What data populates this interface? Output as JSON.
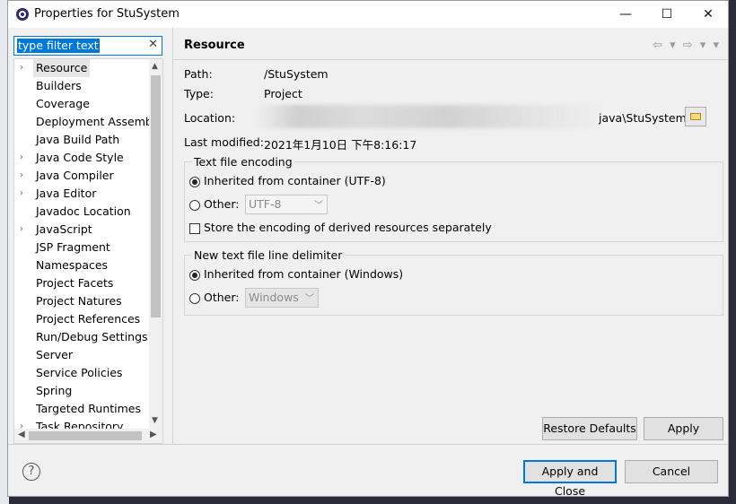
{
  "window": {
    "title": "Properties for StuSystem",
    "minimize": "—",
    "maximize": "☐",
    "close": "✕"
  },
  "filter": {
    "value": "type filter text",
    "clear": "✕"
  },
  "tree": {
    "items": [
      {
        "label": "Resource",
        "arrow": "›",
        "selected": true
      },
      {
        "label": "Builders",
        "arrow": ""
      },
      {
        "label": "Coverage",
        "arrow": ""
      },
      {
        "label": "Deployment Assembly",
        "arrow": ""
      },
      {
        "label": "Java Build Path",
        "arrow": ""
      },
      {
        "label": "Java Code Style",
        "arrow": "›"
      },
      {
        "label": "Java Compiler",
        "arrow": "›"
      },
      {
        "label": "Java Editor",
        "arrow": "›"
      },
      {
        "label": "Javadoc Location",
        "arrow": ""
      },
      {
        "label": "JavaScript",
        "arrow": "›"
      },
      {
        "label": "JSP Fragment",
        "arrow": ""
      },
      {
        "label": "Namespaces",
        "arrow": ""
      },
      {
        "label": "Project Facets",
        "arrow": ""
      },
      {
        "label": "Project Natures",
        "arrow": ""
      },
      {
        "label": "Project References",
        "arrow": ""
      },
      {
        "label": "Run/Debug Settings",
        "arrow": ""
      },
      {
        "label": "Server",
        "arrow": ""
      },
      {
        "label": "Service Policies",
        "arrow": ""
      },
      {
        "label": "Spring",
        "arrow": ""
      },
      {
        "label": "Targeted Runtimes",
        "arrow": ""
      },
      {
        "label": "Task Repository",
        "arrow": "›"
      }
    ]
  },
  "page": {
    "title": "Resource",
    "nav_icons": "⇦ ▾ ⇨ ▾ ▾",
    "path_label": "Path:",
    "path_value": "/StuSystem",
    "type_label": "Type:",
    "type_value": "Project",
    "location_label": "Location:",
    "location_value": "java\\StuSystem",
    "modified_label": "Last modified:",
    "modified_value": "2021年1月10日 下午8:16:17"
  },
  "encoding": {
    "title": "Text file encoding",
    "inherited": "Inherited from container (UTF-8)",
    "other": "Other:",
    "other_value": "UTF-8",
    "store": "Store the encoding of derived resources separately"
  },
  "delimiter": {
    "title": "New text file line delimiter",
    "inherited": "Inherited from container (Windows)",
    "other": "Other:",
    "other_value": "Windows"
  },
  "buttons": {
    "restore": "Restore Defaults",
    "apply": "Apply",
    "apply_close": "Apply and Close",
    "cancel": "Cancel",
    "help": "?"
  }
}
